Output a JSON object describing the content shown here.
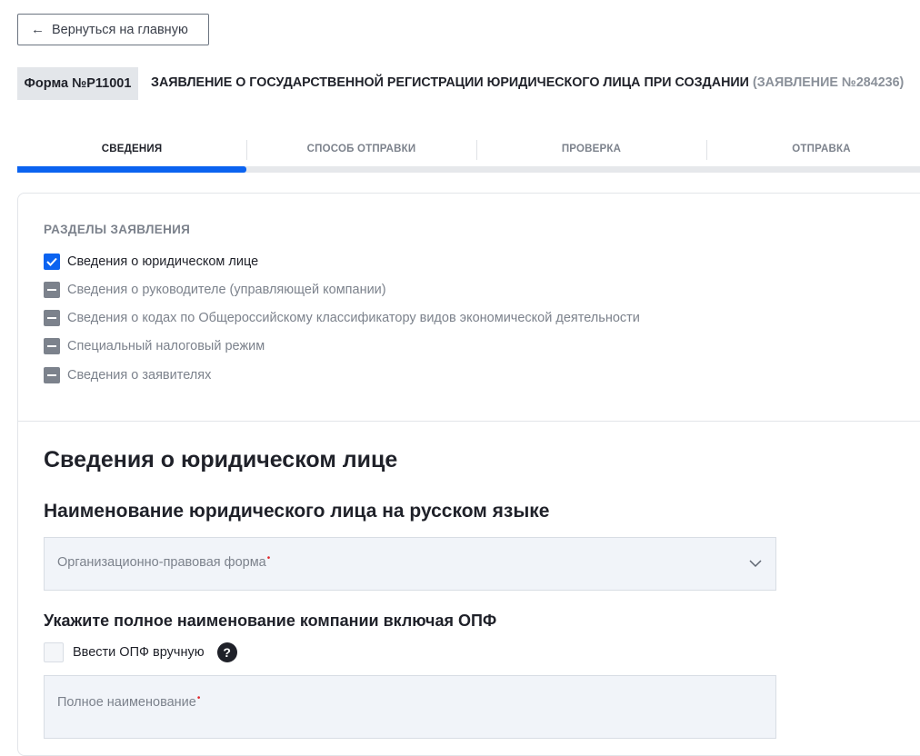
{
  "back_button": {
    "label": "Вернуться на главную",
    "icon": "arrow-left-icon"
  },
  "form": {
    "badge": "Форма №Р11001",
    "title": "ЗАЯВЛЕНИЕ О ГОСУДАРСТВЕННОЙ РЕГИСТРАЦИИ ЮРИДИЧЕСКОГО ЛИЦА ПРИ СОЗДАНИИ",
    "number": "(ЗАЯВЛЕНИЕ №284236)"
  },
  "steps": [
    {
      "label": "СВЕДЕНИЯ",
      "active": true
    },
    {
      "label": "СПОСОБ ОТПРАВКИ",
      "active": false
    },
    {
      "label": "ПРОВЕРКА",
      "active": false
    },
    {
      "label": "ОТПРАВКА",
      "active": false
    }
  ],
  "progress": {
    "current_step": 1,
    "total_steps": 4
  },
  "sections": {
    "title": "РАЗДЕЛЫ ЗАЯВЛЕНИЯ",
    "items": [
      {
        "label": "Сведения о юридическом лице",
        "state": "checked"
      },
      {
        "label": "Сведения о руководителе (управляющей компании)",
        "state": "indeterminate"
      },
      {
        "label": "Сведения о кодах по Общероссийскому классификатору видов экономической деятельности",
        "state": "indeterminate"
      },
      {
        "label": "Специальный налоговый режим",
        "state": "indeterminate"
      },
      {
        "label": "Сведения о заявителях",
        "state": "indeterminate"
      }
    ]
  },
  "main": {
    "heading": "Сведения о юридическом лице",
    "subheading": "Наименование юридического лица на русском языке",
    "opf_select": {
      "placeholder": "Организационно-правовая форма",
      "required": "•"
    },
    "full_name_heading": "Укажите полное наименование компании включая ОПФ",
    "manual_opf": {
      "label": "Ввести ОПФ вручную",
      "checked": false,
      "help": "?"
    },
    "full_name_input": {
      "placeholder": "Полное наименование",
      "required": "•"
    }
  },
  "colors": {
    "accent": "#0b63f0",
    "required": "#e0262c",
    "muted": "#7c828c"
  }
}
